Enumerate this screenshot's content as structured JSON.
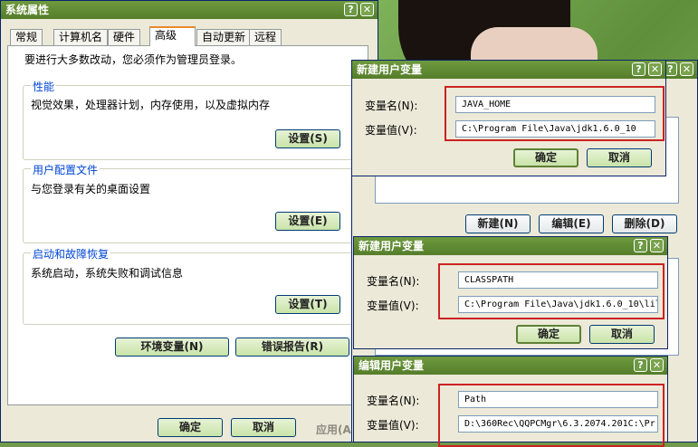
{
  "sysprops": {
    "title": "系统属性",
    "tabs": [
      "常规",
      "计算机名",
      "硬件",
      "高级",
      "自动更新",
      "远程"
    ],
    "note": "要进行大多数改动，您必须作为管理员登录。",
    "perf": {
      "title": "性能",
      "desc": "视觉效果，处理器计划，内存使用，以及虚拟内存",
      "button": "设置(S)"
    },
    "profile": {
      "title": "用户配置文件",
      "desc": "与您登录有关的桌面设置",
      "button": "设置(E)"
    },
    "startup": {
      "title": "启动和故障恢复",
      "desc": "系统启动，系统失败和调试信息",
      "button": "设置(T)"
    },
    "env_button": "环境变量(N)",
    "error_button": "错误报告(R)",
    "ok": "确定",
    "cancel": "取消",
    "apply": "应用(A"
  },
  "envvars": {
    "new_btn": "新建(N)",
    "edit_btn": "编辑(E)",
    "delete_btn": "删除(D)"
  },
  "dialogs": [
    {
      "title": "新建用户变量",
      "name_label": "变量名(N):",
      "value_label": "变量值(V):",
      "name": "JAVA_HOME",
      "value": "C:\\Program File\\Java\\jdk1.6.0_10",
      "ok": "确定",
      "cancel": "取消"
    },
    {
      "title": "新建用户变量",
      "name_label": "变量名(N):",
      "value_label": "变量值(V):",
      "name": "CLASSPATH",
      "value": "C:\\Program File\\Java\\jdk1.6.0_10\\lil",
      "ok": "确定",
      "cancel": "取消"
    },
    {
      "title": "编辑用户变量",
      "name_label": "变量名(N):",
      "value_label": "变量值(V):",
      "name": "Path",
      "value": "D:\\360Rec\\QQPCMgr\\6.3.2074.201C:\\Pr"
    }
  ]
}
